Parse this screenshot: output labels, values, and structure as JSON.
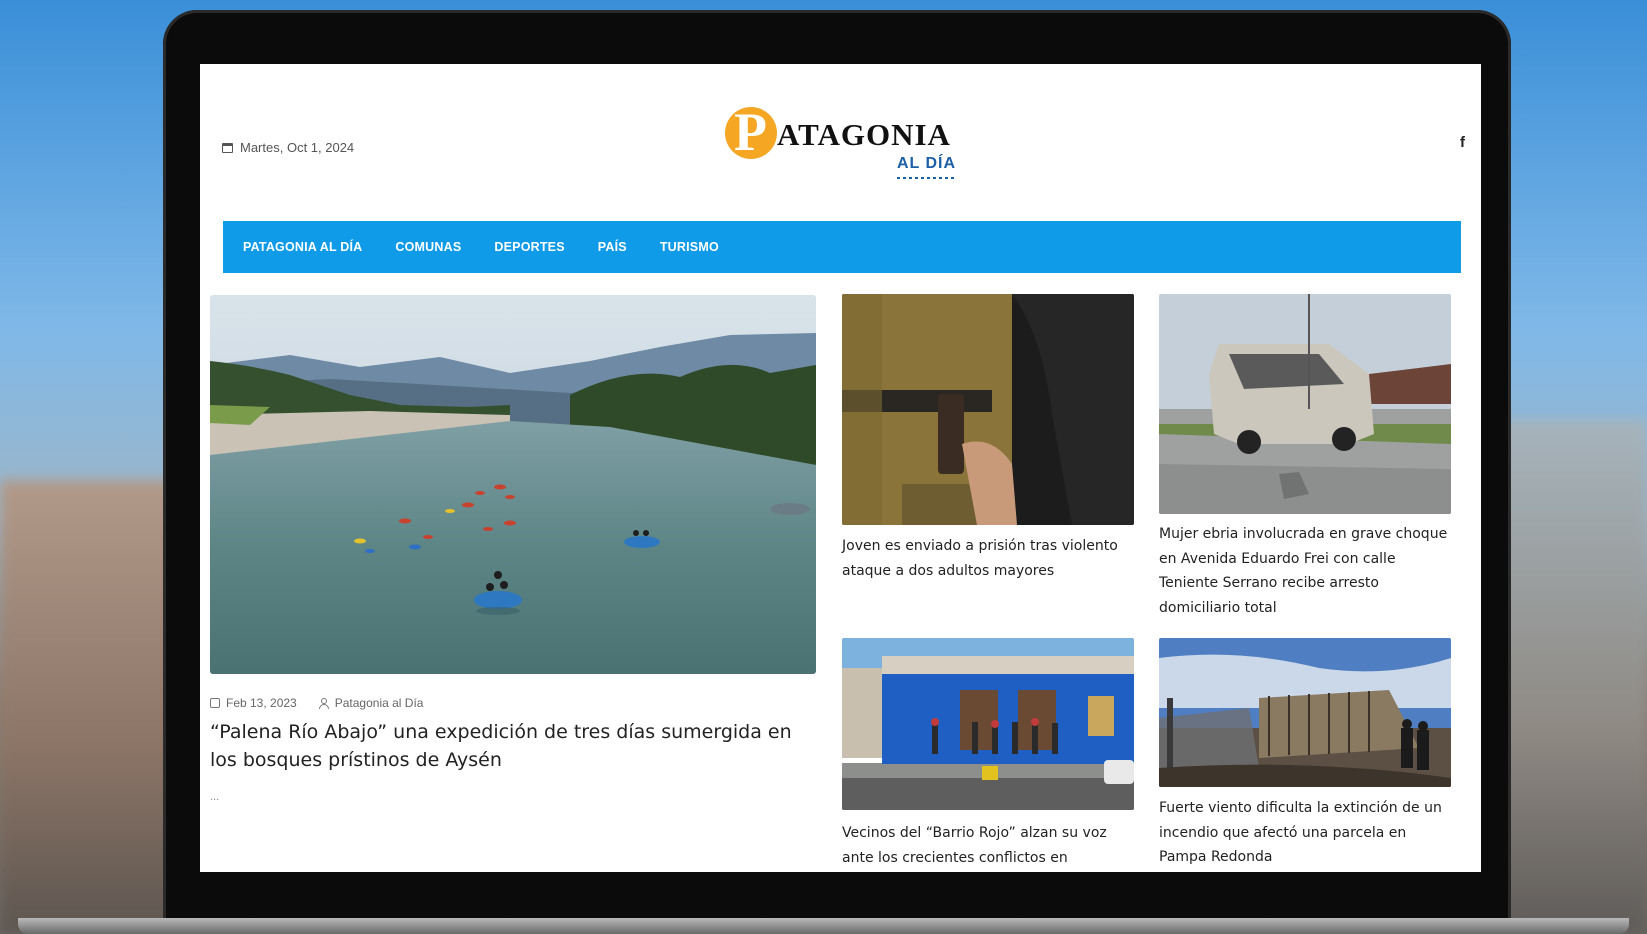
{
  "header": {
    "date": "Martes, Oct 1, 2024",
    "logo_letter": "P",
    "logo_main": "ATAGONIA",
    "logo_sub": "AL DÍA",
    "social_label": "f"
  },
  "nav": {
    "items": [
      {
        "label": "PATAGONIA AL DÍA"
      },
      {
        "label": "COMUNAS"
      },
      {
        "label": "DEPORTES"
      },
      {
        "label": "PAÍS"
      },
      {
        "label": "TURISMO"
      }
    ]
  },
  "feature": {
    "date": "Feb 13, 2023",
    "author": "Patagonia al Día",
    "title": "“Palena Río Abajo” una expedición de tres días sumergida en los bosques prístinos de Aysén",
    "excerpt": "..."
  },
  "cards": [
    {
      "title": "Joven es enviado a prisión tras violento ataque a dos adultos mayores"
    },
    {
      "title": "Mujer ebria involucrada en grave choque en Avenida Eduardo Frei con calle Teniente Serrano recibe arresto domiciliario total"
    },
    {
      "title": "Vecinos del “Barrio Rojo” alzan su voz ante los crecientes conflictos en"
    },
    {
      "title": "Fuerte viento dificulta la extinción de un incendio que afectó una parcela en Pampa Redonda"
    }
  ],
  "colors": {
    "nav_bg": "#0f9be8",
    "logo_accent": "#f5a623",
    "logo_sub": "#1d5fa8"
  }
}
